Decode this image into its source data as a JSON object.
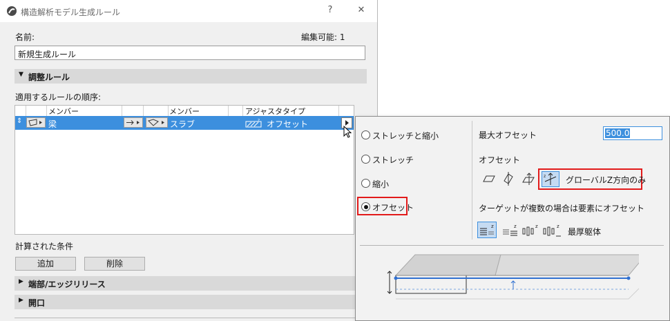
{
  "window": {
    "title": "構造解析モデル生成ルール",
    "help": "?",
    "close": "✕"
  },
  "name_field": {
    "label": "名前:",
    "value": "新規生成ルール"
  },
  "editable": "編集可能: 1",
  "sections": {
    "adjust": "調整ルール",
    "ends": "端部/エッジリリース",
    "opening": "開口"
  },
  "rules": {
    "order_label": "適用するルールの順序:",
    "headers": {
      "member1": "メンバー",
      "member2": "メンバー",
      "alignment": "アジャスタタイプ"
    },
    "row": {
      "member1": "梁",
      "member2": "スラブ",
      "type": "オフセット"
    }
  },
  "calculated_label": "計算された条件",
  "buttons": {
    "add": "追加",
    "delete": "削除"
  },
  "popup": {
    "options": [
      "ストレッチと縮小",
      "ストレッチ",
      "縮小",
      "オフセット"
    ],
    "selected_option": "オフセット",
    "max_offset_label": "最大オフセット",
    "max_offset_value": "500.0",
    "offset_label": "オフセット",
    "global_z_label": "グローバルZ方向のみ",
    "multi_target_label": "ターゲットが複数の場合は要素にオフセット",
    "thickest_label": "最厚躯体"
  },
  "colors": {
    "selection": "#3c8fde",
    "highlight_border": "#e21a1a"
  }
}
